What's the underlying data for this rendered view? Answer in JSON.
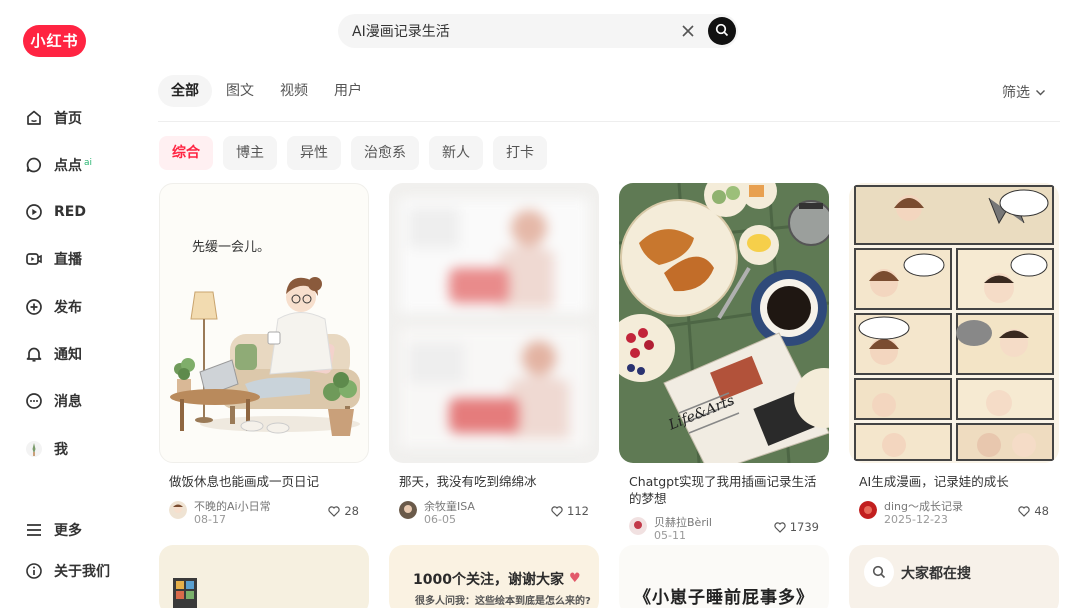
{
  "brand": {
    "logo_text": "小红书",
    "accent": "#ff2442"
  },
  "sidebar": {
    "items": [
      {
        "label": "首页",
        "icon": "home-icon"
      },
      {
        "label": "点点",
        "icon": "chat-bubble-icon",
        "badge": "ai"
      },
      {
        "label": "RED",
        "icon": "play-circle-icon"
      },
      {
        "label": "直播",
        "icon": "live-icon"
      },
      {
        "label": "发布",
        "icon": "plus-square-icon"
      },
      {
        "label": "通知",
        "icon": "bell-icon"
      },
      {
        "label": "消息",
        "icon": "message-icon"
      },
      {
        "label": "我",
        "icon": "avatar"
      }
    ],
    "more_label": "更多",
    "about_label": "关于我们"
  },
  "search": {
    "value": "AI漫画记录生活"
  },
  "tabs": [
    {
      "label": "全部",
      "active": true
    },
    {
      "label": "图文"
    },
    {
      "label": "视频"
    },
    {
      "label": "用户"
    }
  ],
  "filter_label": "筛选",
  "chips": [
    {
      "label": "综合",
      "active": true
    },
    {
      "label": "博主"
    },
    {
      "label": "异性"
    },
    {
      "label": "治愈系"
    },
    {
      "label": "新人"
    },
    {
      "label": "打卡"
    }
  ],
  "cards": [
    {
      "title": "做饭休息也能画成一页日记",
      "author": "不晚的Ai小日常",
      "date": "08-17",
      "likes": "28",
      "image_text": "先缓一会儿。"
    },
    {
      "title": "那天，我没有吃到绵绵冰",
      "author": "余牧童ISA",
      "date": "06-05",
      "likes": "112"
    },
    {
      "title": "Chatgpt实现了我用插画记录生活的梦想",
      "author": "贝赫拉Bèril",
      "date": "05-11",
      "likes": "1739",
      "image_text": "Life&Arts"
    },
    {
      "title": "AI生成漫画，记录娃的成长",
      "author": "ding～成长记录",
      "date": "2025-12-23",
      "likes": "48"
    }
  ],
  "bottom_cards": [
    {
      "image_text": "1000个关注，谢谢大家",
      "image_subtext": "很多人问我：这些绘本到底是怎么来的?"
    },
    {
      "image_text": "《小崽子睡前屁事多》"
    },
    {
      "label": "大家都在搜"
    }
  ]
}
